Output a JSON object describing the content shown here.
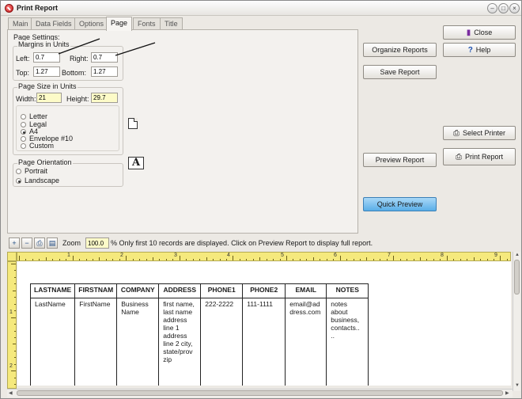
{
  "window": {
    "title": "Print Report"
  },
  "tabs": [
    "Main",
    "Data Fields",
    "Options",
    "Page",
    "Fonts",
    "Title"
  ],
  "active_tab": "Page",
  "page_settings": {
    "heading": "Page Settings:",
    "margins": {
      "heading": "Margins in Units",
      "left_label": "Left:",
      "left_value": "0.7",
      "right_label": "Right:",
      "right_value": "0.7",
      "top_label": "Top:",
      "top_value": "1.27",
      "bottom_label": "Bottom:",
      "bottom_value": "1.27"
    },
    "page_size": {
      "heading": "Page Size in Units",
      "width_label": "Width:",
      "width_value": "21",
      "height_label": "Height:",
      "height_value": "29.7",
      "options": [
        "Letter",
        "Legal",
        "A4",
        "Envelope #10",
        "Custom"
      ],
      "selected": "A4"
    },
    "orientation": {
      "heading": "Page Orientation",
      "options": [
        "Portrait",
        "Landscape"
      ],
      "selected": "Landscape"
    }
  },
  "buttons": {
    "organize_reports": "Organize Reports",
    "save_report": "Save Report",
    "preview_report": "Preview Report",
    "quick_preview": "Quick Preview",
    "close": "Close",
    "help": "Help",
    "select_printer": "Select Printer",
    "print_report": "Print Report"
  },
  "toolbar": {
    "zoom_label": "Zoom",
    "zoom_value": "100.0",
    "message": "% Only first 10 records are displayed. Click on Preview Report to display full report."
  },
  "ruler": {
    "h_numbers": [
      "1",
      "2",
      "3",
      "4",
      "5",
      "6",
      "7",
      "8",
      "9"
    ],
    "v_numbers": [
      "1",
      "2"
    ]
  },
  "report": {
    "headers": [
      "LASTNAME",
      "FIRSTNAM",
      "COMPANY",
      "ADDRESS",
      "PHONE1",
      "PHONE2",
      "EMAIL",
      "NOTES"
    ],
    "row": [
      "LastName",
      "FirstName",
      "Business Name",
      "first name, last name address line 1 address line 2 city, state/prov zip",
      "222-2222",
      "111-1111",
      "email@address.com",
      "notes about business, contacts.. .."
    ]
  },
  "colors": {
    "quick_preview": "#5aaee8",
    "ruler": "#f5e97d",
    "input_highlight": "#fdfbc8"
  },
  "icons": [
    "app-icon",
    "close-door-icon",
    "help-question-icon",
    "printer-icon",
    "zoom-in-icon",
    "zoom-out-icon",
    "page-icon",
    "font-a-icon"
  ]
}
